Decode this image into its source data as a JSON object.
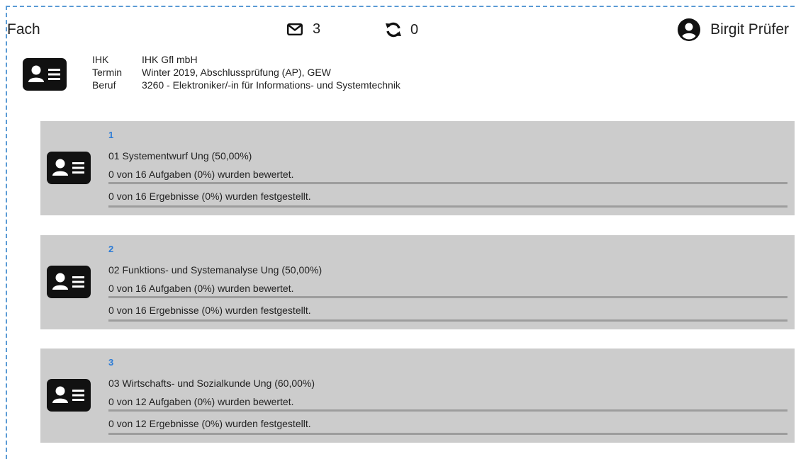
{
  "header": {
    "title": "Fach",
    "messages_count": "3",
    "sync_count": "0",
    "user_name": "Birgit Prüfer"
  },
  "exam_info": {
    "ihk_label": "IHK",
    "ihk_value": "IHK Gfl mbH",
    "termin_label": "Termin",
    "termin_value": "Winter 2019, Abschlussprüfung (AP), GEW",
    "beruf_label": "Beruf",
    "beruf_value": "3260 - Elektroniker/-in für Informations- und Systemtechnik"
  },
  "subjects": [
    {
      "number": "1",
      "title": "01 Systementwurf Ung (50,00%)",
      "tasks_text": "0 von 16 Aufgaben (0%) wurden bewertet.",
      "results_text": "0 von 16 Ergebnisse (0%) wurden festgestellt.",
      "tasks_progress": 0,
      "results_progress": 0
    },
    {
      "number": "2",
      "title": "02 Funktions- und Systemanalyse Ung (50,00%)",
      "tasks_text": "0 von 16 Aufgaben (0%) wurden bewertet.",
      "results_text": "0 von 16 Ergebnisse (0%) wurden festgestellt.",
      "tasks_progress": 0,
      "results_progress": 0
    },
    {
      "number": "3",
      "title": "03 Wirtschafts- und Sozialkunde Ung (60,00%)",
      "tasks_text": "0 von 12 Aufgaben (0%) wurden bewertet.",
      "results_text": "0 von 12 Ergebnisse (0%) wurden festgestellt.",
      "tasks_progress": 0,
      "results_progress": 0
    }
  ],
  "icons": {
    "messages": "envelope-icon",
    "sync": "sync-icon",
    "user": "user-circle-icon",
    "card": "id-card-icon"
  },
  "colors": {
    "accent": "#2b7bd6",
    "card_bg": "#cccccc",
    "progress_track": "#9d9d9d",
    "frame_border": "#5b9bd5"
  }
}
